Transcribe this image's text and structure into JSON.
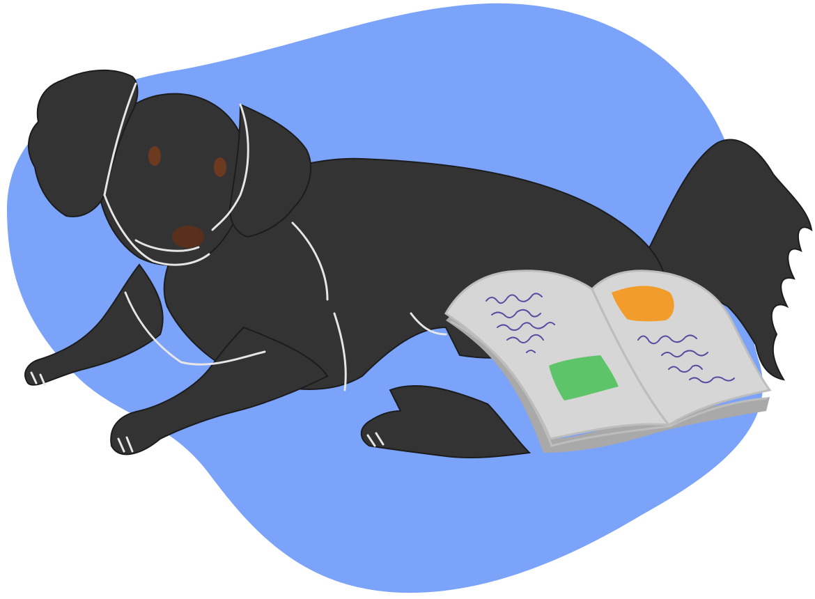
{
  "colors": {
    "background": "#ffffff",
    "blob": "#7ba3fa",
    "dog": "#333333",
    "dog_outline": "#1c1c1c",
    "highlight": "#e6e6e6",
    "eye": "#6e3a1f",
    "nose": "#5a2f1c",
    "book_page": "#d6d6d6",
    "book_edge": "#bdbdbd",
    "book_shadow": "#a9a9a9",
    "scribble": "#5b4aa0",
    "orange_sticker": "#f29c2b",
    "green_sticker": "#5ec46a"
  },
  "icons": {
    "background_shape": "blue-blob-icon",
    "subject": "black-dog-lying-icon",
    "object": "open-book-icon"
  }
}
